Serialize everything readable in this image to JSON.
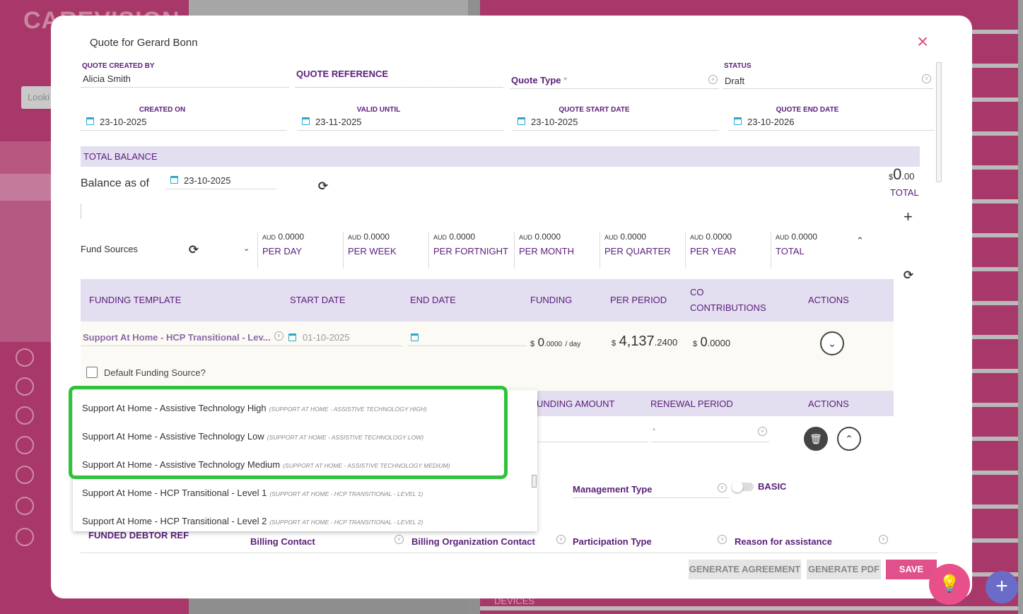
{
  "background": {
    "logo": "CAREVISION",
    "search_placeholder": "Looki",
    "devices_label": "DEVICES"
  },
  "modal": {
    "title": "Quote for Gerard Bonn",
    "quote_created_by_label": "QUOTE CREATED BY",
    "quote_created_by": "Alicia Smith",
    "quote_reference_label": "QUOTE REFERENCE",
    "quote_type_label": "Quote Type",
    "required_mark": "*",
    "status_label": "STATUS",
    "status": "Draft",
    "created_on_label": "CREATED ON",
    "created_on": "23-10-2025",
    "valid_until_label": "VALID UNTIL",
    "valid_until": "23-11-2025",
    "quote_start_label": "QUOTE START DATE",
    "quote_start": "23-10-2025",
    "quote_end_label": "QUOTE END DATE",
    "quote_end": "23-10-2026"
  },
  "balance": {
    "section_title": "TOTAL BALANCE",
    "balance_as_of_label": "Balance as of",
    "balance_date": "23-10-2025",
    "currency": "$",
    "total_whole": "0",
    "total_decimal": ".00",
    "total_label": "TOTAL"
  },
  "fund_sources": {
    "label": "Fund Sources",
    "periods": [
      {
        "currency": "AUD",
        "amount": "0.0000",
        "label": "PER DAY"
      },
      {
        "currency": "AUD",
        "amount": "0.0000",
        "label": "PER WEEK"
      },
      {
        "currency": "AUD",
        "amount": "0.0000",
        "label": "PER FORTNIGHT"
      },
      {
        "currency": "AUD",
        "amount": "0.0000",
        "label": "PER MONTH"
      },
      {
        "currency": "AUD",
        "amount": "0.0000",
        "label": "PER QUARTER"
      },
      {
        "currency": "AUD",
        "amount": "0.0000",
        "label": "PER YEAR"
      },
      {
        "currency": "AUD",
        "amount": "0.0000",
        "label": "TOTAL"
      }
    ]
  },
  "funding_table": {
    "headers": [
      "FUNDING TEMPLATE",
      "START DATE",
      "END DATE",
      "FUNDING",
      "PER PERIOD",
      "CO",
      "CONTRIBUTIONS",
      "ACTIONS"
    ],
    "row": {
      "template": "Support At Home - HCP Transitional - Lev...",
      "start_date": "01-10-2025",
      "funding_currency": "$",
      "funding_whole": "0",
      "funding_decimal": ".0000",
      "funding_unit": "/ day",
      "per_period_currency": "$",
      "per_period_whole": "4,137",
      "per_period_decimal": ".2400",
      "co_currency": "$",
      "co_whole": "0",
      "co_decimal": ".0000"
    },
    "default_funding_label": "Default Funding Source?"
  },
  "sub_table": {
    "headers": [
      "UNDING AMOUNT",
      "RENEWAL PERIOD",
      "ACTIONS"
    ],
    "renewal_placeholder": "*",
    "management_type_label": "Management Type",
    "toggle_label": "BASIC",
    "funded_debtor_ref": "FUNDED DEBTOR REF",
    "billing_contact": "Billing Contact",
    "billing_org_contact": "Billing Organization Contact",
    "participation_type": "Participation Type",
    "reason": "Reason for assistance"
  },
  "dropdown": {
    "items": [
      {
        "label": "Support At Home - Assistive Technology High",
        "code": "(SUPPORT AT HOME - ASSISTIVE TECHNOLOGY HIGH)"
      },
      {
        "label": "Support At Home - Assistive Technology Low",
        "code": "(SUPPORT AT HOME - ASSISTIVE TECHNOLOGY LOW)"
      },
      {
        "label": "Support At Home - Assistive Technology Medium",
        "code": "(SUPPORT AT HOME - ASSISTIVE TECHNOLOGY MEDIUM)"
      },
      {
        "label": "Support At Home - HCP Transitional - Level 1",
        "code": "(SUPPORT AT HOME - HCP TRANSITIONAL - LEVEL 1)"
      },
      {
        "label": "Support At Home - HCP Transitional - Level 2",
        "code": "(SUPPORT AT HOME - HCP TRANSITIONAL - LEVEL 2)"
      }
    ]
  },
  "footer": {
    "generate_agreement": "GENERATE AGREEMENT",
    "generate_pdf": "GENERATE PDF",
    "save": "SAVE"
  },
  "colors": {
    "brand_pink": "#e0508a",
    "purple_label": "#5a1e7a",
    "header_band": "#e3def0",
    "highlight_green": "#2fc23a"
  }
}
